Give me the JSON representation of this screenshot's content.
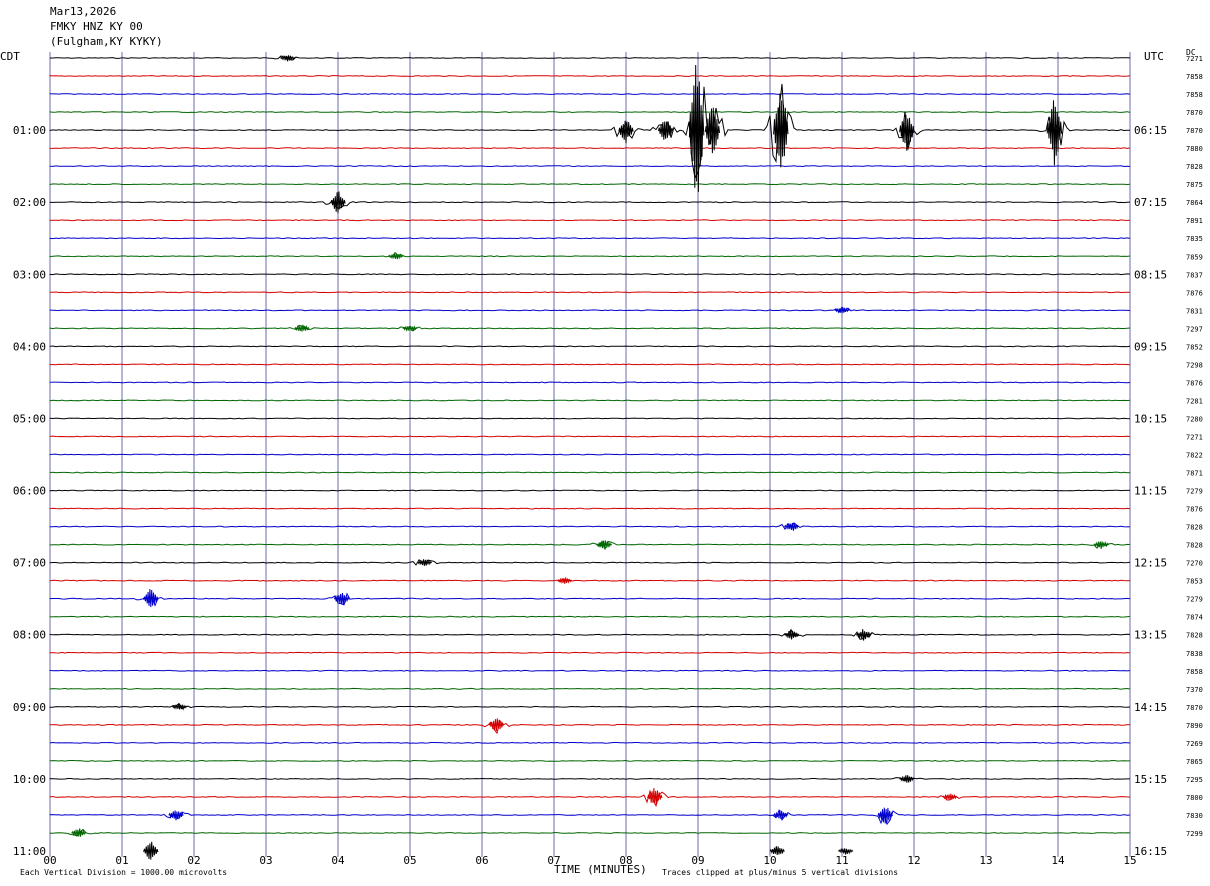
{
  "header": {
    "date": "Mar13,2026",
    "station": "FMKY HNZ KY 00",
    "location": "(Fulgham,KY KYKY)"
  },
  "left_zone": "CDT",
  "right_zone": "UTC",
  "dc_label": "DC",
  "footer": {
    "scale": "Each Vertical Division = 1000.00 microvolts",
    "xlabel": "TIME (MINUTES)",
    "clip_note": "Traces clipped at plus/minus 5 vertical divisions"
  },
  "colors": {
    "trace_cycle": [
      "#000000",
      "#d40000",
      "#0000cc",
      "#006600"
    ],
    "grid_vertical": "#6b6bab"
  },
  "chart_data": {
    "type": "line",
    "title": "",
    "xlabel": "TIME (MINUTES)",
    "xlim": [
      0,
      15
    ],
    "x_ticks": [
      "00",
      "01",
      "02",
      "03",
      "04",
      "05",
      "06",
      "07",
      "08",
      "09",
      "10",
      "11",
      "12",
      "13",
      "14",
      "15"
    ],
    "trace_interval_minutes": 15,
    "left_hour_labels": [
      "01:00",
      "02:00",
      "03:00",
      "04:00",
      "05:00",
      "06:00",
      "07:00",
      "08:00",
      "09:00",
      "10:00",
      "11:00"
    ],
    "right_hour_labels": [
      "06:15",
      "07:15",
      "08:15",
      "09:15",
      "10:15",
      "11:15",
      "12:15",
      "13:15",
      "14:15",
      "15:15",
      "16:15"
    ],
    "dc_offsets": [
      "7271",
      "7858",
      "7858",
      "7870",
      "7870",
      "7880",
      "7828",
      "7875",
      "7864",
      "7891",
      "7835",
      "7859",
      "7837",
      "7876",
      "7831",
      "7297",
      "7852",
      "7298",
      "7876",
      "7281",
      "7280",
      "7271",
      "7822",
      "7871",
      "7279",
      "7876",
      "7828",
      "7828",
      "7270",
      "7853",
      "7279",
      "7874",
      "7828",
      "7838",
      "7858",
      "7370",
      "7870",
      "7890",
      "7269",
      "7865",
      "7295",
      "7800",
      "7830",
      "7299"
    ],
    "events": [
      {
        "trace": 0,
        "minute": 3.3,
        "amp": 0.2
      },
      {
        "trace": 4,
        "minute": 8.0,
        "amp": 0.8
      },
      {
        "trace": 4,
        "minute": 8.55,
        "amp": 0.7
      },
      {
        "trace": 4,
        "minute": 8.98,
        "amp": 4.5
      },
      {
        "trace": 4,
        "minute": 9.2,
        "amp": 1.6
      },
      {
        "trace": 4,
        "minute": 10.15,
        "amp": 2.8
      },
      {
        "trace": 4,
        "minute": 11.9,
        "amp": 1.2
      },
      {
        "trace": 4,
        "minute": 13.95,
        "amp": 2.2
      },
      {
        "trace": 8,
        "minute": 4.0,
        "amp": 0.7
      },
      {
        "trace": 11,
        "minute": 4.8,
        "amp": 0.2
      },
      {
        "trace": 14,
        "minute": 11.0,
        "amp": 0.2
      },
      {
        "trace": 15,
        "minute": 3.5,
        "amp": 0.25
      },
      {
        "trace": 15,
        "minute": 5.0,
        "amp": 0.2
      },
      {
        "trace": 26,
        "minute": 10.3,
        "amp": 0.3
      },
      {
        "trace": 27,
        "minute": 7.7,
        "amp": 0.3
      },
      {
        "trace": 27,
        "minute": 14.6,
        "amp": 0.25
      },
      {
        "trace": 28,
        "minute": 5.2,
        "amp": 0.25
      },
      {
        "trace": 29,
        "minute": 7.15,
        "amp": 0.2
      },
      {
        "trace": 30,
        "minute": 1.4,
        "amp": 0.6
      },
      {
        "trace": 30,
        "minute": 4.05,
        "amp": 0.45
      },
      {
        "trace": 32,
        "minute": 10.3,
        "amp": 0.3
      },
      {
        "trace": 32,
        "minute": 11.3,
        "amp": 0.35
      },
      {
        "trace": 36,
        "minute": 1.8,
        "amp": 0.2
      },
      {
        "trace": 37,
        "minute": 6.2,
        "amp": 0.5
      },
      {
        "trace": 40,
        "minute": 11.9,
        "amp": 0.3
      },
      {
        "trace": 41,
        "minute": 8.4,
        "amp": 0.6
      },
      {
        "trace": 41,
        "minute": 12.5,
        "amp": 0.2
      },
      {
        "trace": 42,
        "minute": 1.75,
        "amp": 0.35
      },
      {
        "trace": 42,
        "minute": 10.15,
        "amp": 0.3
      },
      {
        "trace": 42,
        "minute": 11.6,
        "amp": 0.6
      },
      {
        "trace": 43,
        "minute": 0.4,
        "amp": 0.3
      },
      {
        "trace": 44,
        "minute": 1.4,
        "amp": 0.6
      },
      {
        "trace": 44,
        "minute": 10.1,
        "amp": 0.3
      },
      {
        "trace": 44,
        "minute": 11.05,
        "amp": 0.2
      }
    ]
  }
}
